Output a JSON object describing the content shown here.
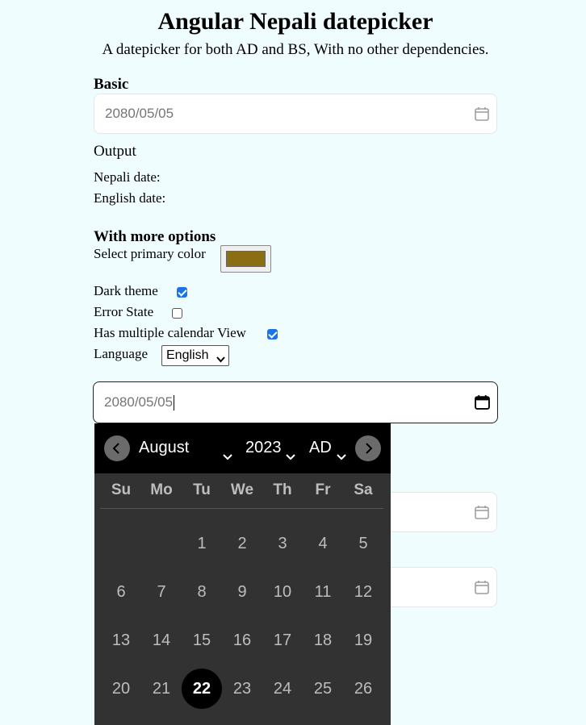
{
  "page": {
    "title": "Angular Nepali datepicker",
    "subtitle": "A datepicker for both AD and BS, With no other dependencies."
  },
  "basic": {
    "heading": "Basic",
    "input_value": "2080/05/05"
  },
  "output": {
    "heading": "Output",
    "nepali_label": "Nepali date:",
    "english_label": "English date:"
  },
  "options": {
    "heading": "With more options",
    "primary_color_label": "Select primary color",
    "primary_color": "#8b6e14",
    "dark_theme_label": "Dark theme",
    "dark_theme": true,
    "error_state_label": "Error State",
    "error_state": false,
    "multi_view_label": "Has multiple calendar View",
    "multi_view": true,
    "language_label": "Language",
    "language_value": "English"
  },
  "advanced": {
    "input_value": "2080/05/05"
  },
  "picker": {
    "month": "August",
    "year": "2023",
    "calendar_type": "AD",
    "weekdays": [
      "Su",
      "Mo",
      "Tu",
      "We",
      "Th",
      "Fr",
      "Sa"
    ],
    "weeks": [
      [
        "",
        "",
        "1",
        "2",
        "3",
        "4",
        "5"
      ],
      [
        "6",
        "7",
        "8",
        "9",
        "10",
        "11",
        "12"
      ],
      [
        "13",
        "14",
        "15",
        "16",
        "17",
        "18",
        "19"
      ],
      [
        "20",
        "21",
        "22",
        "23",
        "24",
        "25",
        "26"
      ]
    ],
    "selected_day": "22"
  },
  "colors": {
    "background": "#f0fdff",
    "picker_bg": "#323232",
    "picker_header": "#000000",
    "checkbox_accent": "#1a73e8"
  }
}
